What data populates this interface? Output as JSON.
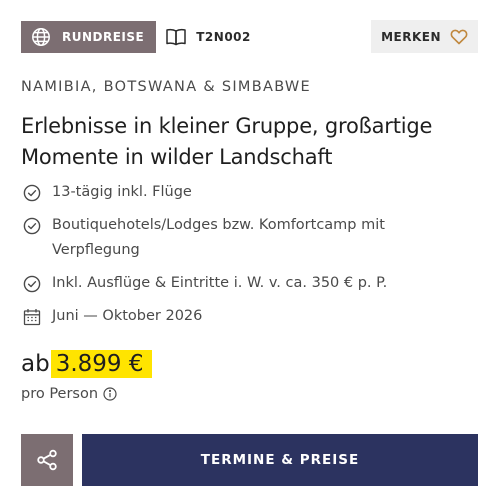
{
  "header": {
    "trip_type_label": "RUNDREISE",
    "trip_type_icon": "globe-icon",
    "trip_code": "T2N002",
    "trip_code_icon": "book-icon",
    "merken_label": "MERKEN",
    "merken_icon": "heart-icon"
  },
  "region": "NAMIBIA, BOTSWANA & SIMBABWE",
  "title": "Erlebnisse in kleiner Gruppe, großartige Momente in wilder Landschaft",
  "features": [
    {
      "icon": "check-circle-icon",
      "text": "13-tägig inkl. Flüge"
    },
    {
      "icon": "check-circle-icon",
      "text": "Boutiquehotels/Lodges bzw. Komfortcamp mit Verpflegung"
    },
    {
      "icon": "check-circle-icon",
      "text": "Inkl. Ausflüge & Eintritte i. W. v. ca. 350 € p. P."
    },
    {
      "icon": "calendar-icon",
      "text": "Juni — Oktober 2026"
    }
  ],
  "price": {
    "prefix": "ab",
    "amount": "3.899 €",
    "per_person": "pro Person",
    "info_icon": "info-icon"
  },
  "actions": {
    "share_icon": "share-icon",
    "cta_label": "TERMINE & PREISE"
  },
  "colors": {
    "badge_bg": "#7c6e72",
    "merken_bg": "#efefef",
    "heart": "#c0883e",
    "price_highlight": "#ffe400",
    "cta_bg": "#2c3360"
  }
}
